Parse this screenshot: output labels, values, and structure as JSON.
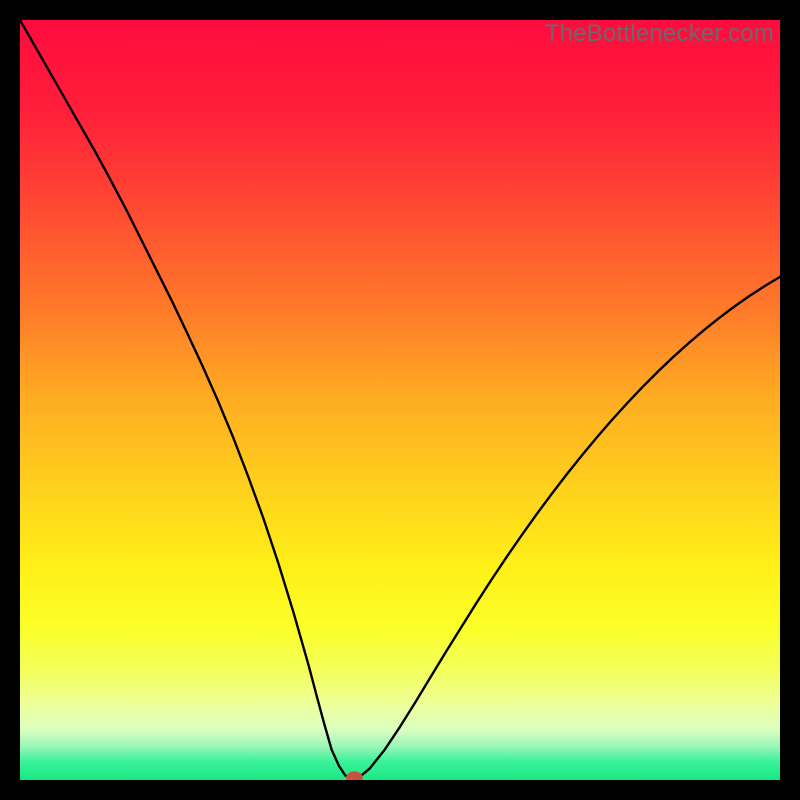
{
  "watermark": "TheBottlenecker.com",
  "chart_data": {
    "type": "line",
    "title": "",
    "xlabel": "",
    "ylabel": "",
    "xlim": [
      0,
      100
    ],
    "ylim": [
      0,
      100
    ],
    "grid": false,
    "legend": false,
    "background_gradient": {
      "stops": [
        {
          "pos": 0.0,
          "color": "#ff0b3e"
        },
        {
          "pos": 0.12,
          "color": "#ff1f3a"
        },
        {
          "pos": 0.25,
          "color": "#ff4a32"
        },
        {
          "pos": 0.38,
          "color": "#ff7a2a"
        },
        {
          "pos": 0.5,
          "color": "#ffad22"
        },
        {
          "pos": 0.62,
          "color": "#ffd21c"
        },
        {
          "pos": 0.72,
          "color": "#fff018"
        },
        {
          "pos": 0.8,
          "color": "#fbff28"
        },
        {
          "pos": 0.86,
          "color": "#f3ff60"
        },
        {
          "pos": 0.905,
          "color": "#ecffa0"
        },
        {
          "pos": 0.935,
          "color": "#d8ffc0"
        },
        {
          "pos": 0.955,
          "color": "#9cf7b8"
        },
        {
          "pos": 0.975,
          "color": "#3cf29b"
        },
        {
          "pos": 1.0,
          "color": "#17e884"
        }
      ]
    },
    "series": [
      {
        "name": "bottleneck-curve",
        "stroke": "#000000",
        "stroke_width": 2.4,
        "x": [
          0,
          2,
          4,
          6,
          8,
          10,
          12,
          14,
          16,
          18,
          20,
          22,
          24,
          26,
          28,
          30,
          32,
          34,
          36,
          38,
          39,
          40,
          41,
          42,
          42.8,
          43.5,
          44,
          44.8,
          46,
          48,
          50,
          52,
          54,
          56,
          58,
          60,
          62,
          64,
          66,
          68,
          70,
          72,
          74,
          76,
          78,
          80,
          82,
          84,
          86,
          88,
          90,
          92,
          94,
          96,
          98,
          100
        ],
        "y": [
          100,
          96.5,
          93,
          89.5,
          86,
          82.5,
          78.8,
          75,
          71,
          67,
          63,
          58.8,
          54.5,
          50,
          45.2,
          40,
          34.5,
          28.5,
          22,
          15,
          11.2,
          7.5,
          4,
          1.8,
          0.6,
          0.2,
          0.2,
          0.5,
          1.5,
          4,
          7,
          10.2,
          13.5,
          16.8,
          20,
          23.2,
          26.3,
          29.3,
          32.2,
          35,
          37.7,
          40.3,
          42.8,
          45.2,
          47.5,
          49.7,
          51.8,
          53.8,
          55.7,
          57.5,
          59.2,
          60.8,
          62.3,
          63.7,
          65,
          66.2
        ]
      }
    ],
    "marker": {
      "name": "optimal-point",
      "x": 44,
      "y": 0.3,
      "rx": 1.1,
      "ry": 0.85,
      "fill": "#c7533e"
    }
  }
}
